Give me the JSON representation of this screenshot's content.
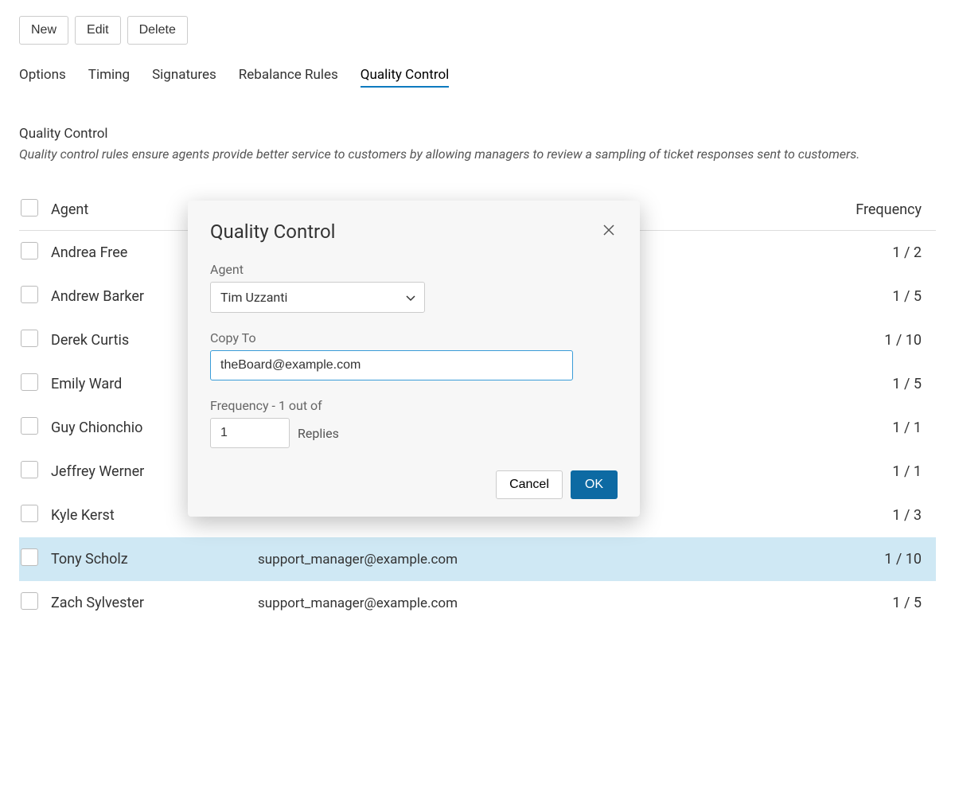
{
  "toolbar": {
    "new_label": "New",
    "edit_label": "Edit",
    "delete_label": "Delete"
  },
  "tabs": [
    {
      "label": "Options",
      "active": false
    },
    {
      "label": "Timing",
      "active": false
    },
    {
      "label": "Signatures",
      "active": false
    },
    {
      "label": "Rebalance Rules",
      "active": false
    },
    {
      "label": "Quality Control",
      "active": true
    }
  ],
  "section": {
    "title": "Quality Control",
    "desc": "Quality control rules ensure agents provide better service to customers by allowing managers to review a sampling of ticket responses sent to customers."
  },
  "table": {
    "headers": {
      "agent": "Agent",
      "frequency": "Frequency"
    },
    "rows": [
      {
        "agent": "Andrea Free",
        "copyto": "",
        "freq": "1 / 2",
        "highlighted": false
      },
      {
        "agent": "Andrew Barker",
        "copyto": "",
        "freq": "1 / 5",
        "highlighted": false
      },
      {
        "agent": "Derek Curtis",
        "copyto": "",
        "freq": "1 / 10",
        "highlighted": false
      },
      {
        "agent": "Emily Ward",
        "copyto": "",
        "freq": "1 / 5",
        "highlighted": false
      },
      {
        "agent": "Guy Chionchio",
        "copyto": "",
        "freq": "1 / 1",
        "highlighted": false
      },
      {
        "agent": "Jeffrey Werner",
        "copyto": "",
        "freq": "1 / 1",
        "highlighted": false
      },
      {
        "agent": "Kyle Kerst",
        "copyto": "",
        "freq": "1 / 3",
        "highlighted": false
      },
      {
        "agent": "Tony Scholz",
        "copyto": "support_manager@example.com",
        "freq": "1 / 10",
        "highlighted": true
      },
      {
        "agent": "Zach Sylvester",
        "copyto": "support_manager@example.com",
        "freq": "1 / 5",
        "highlighted": false
      }
    ]
  },
  "modal": {
    "title": "Quality Control",
    "agent_label": "Agent",
    "agent_value": "Tim Uzzanti",
    "copyto_label": "Copy To",
    "copyto_value": "theBoard@example.com",
    "freq_label": "Frequency - 1 out of",
    "freq_value": "1",
    "replies_label": "Replies",
    "cancel_label": "Cancel",
    "ok_label": "OK"
  }
}
